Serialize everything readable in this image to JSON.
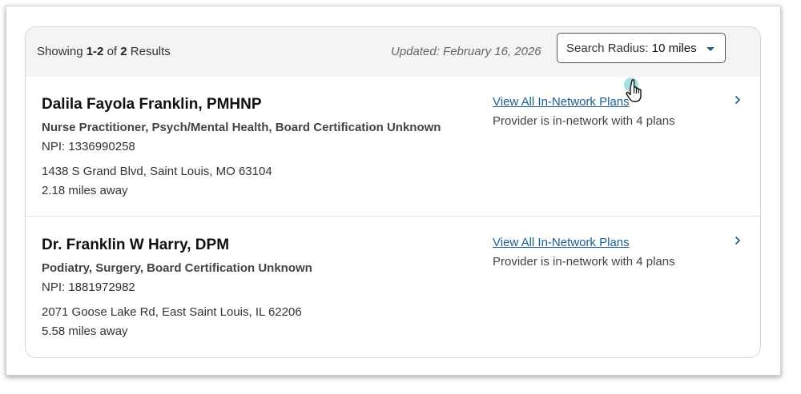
{
  "header": {
    "showing_prefix": "Showing ",
    "showing_range": "1-2",
    "showing_of": " of ",
    "showing_total": "2",
    "showing_suffix": " Results",
    "updated": "Updated: February 16, 2026",
    "radius_label": "Search Radius: ",
    "radius_value": "10 miles"
  },
  "results": [
    {
      "name": "Dalila Fayola Franklin, PMHNP",
      "specialty": "Nurse Practitioner, Psych/Mental Health, Board Certification Unknown",
      "npi": "NPI: 1336990258",
      "address": "1438 S Grand Blvd, Saint Louis, MO 63104",
      "distance": "2.18 miles away",
      "plans_link": "View All In-Network Plans",
      "in_network": "Provider is in-network with 4 plans"
    },
    {
      "name": "Dr. Franklin W Harry, DPM",
      "specialty": "Podiatry, Surgery, Board Certification Unknown",
      "npi": "NPI: 1881972982",
      "address": "2071 Goose Lake Rd, East Saint Louis, IL 62206",
      "distance": "5.58 miles away",
      "plans_link": "View All In-Network Plans",
      "in_network": "Provider is in-network with 4 plans"
    }
  ],
  "icons": {
    "chevron": "chevron-right-icon",
    "cursor": "hand-pointer-cursor-icon",
    "dropdown": "caret-down-icon"
  },
  "colors": {
    "link": "#1d5e8a",
    "header_bg": "#f4f4f4",
    "cursor_highlight": "#5fc3cf"
  }
}
